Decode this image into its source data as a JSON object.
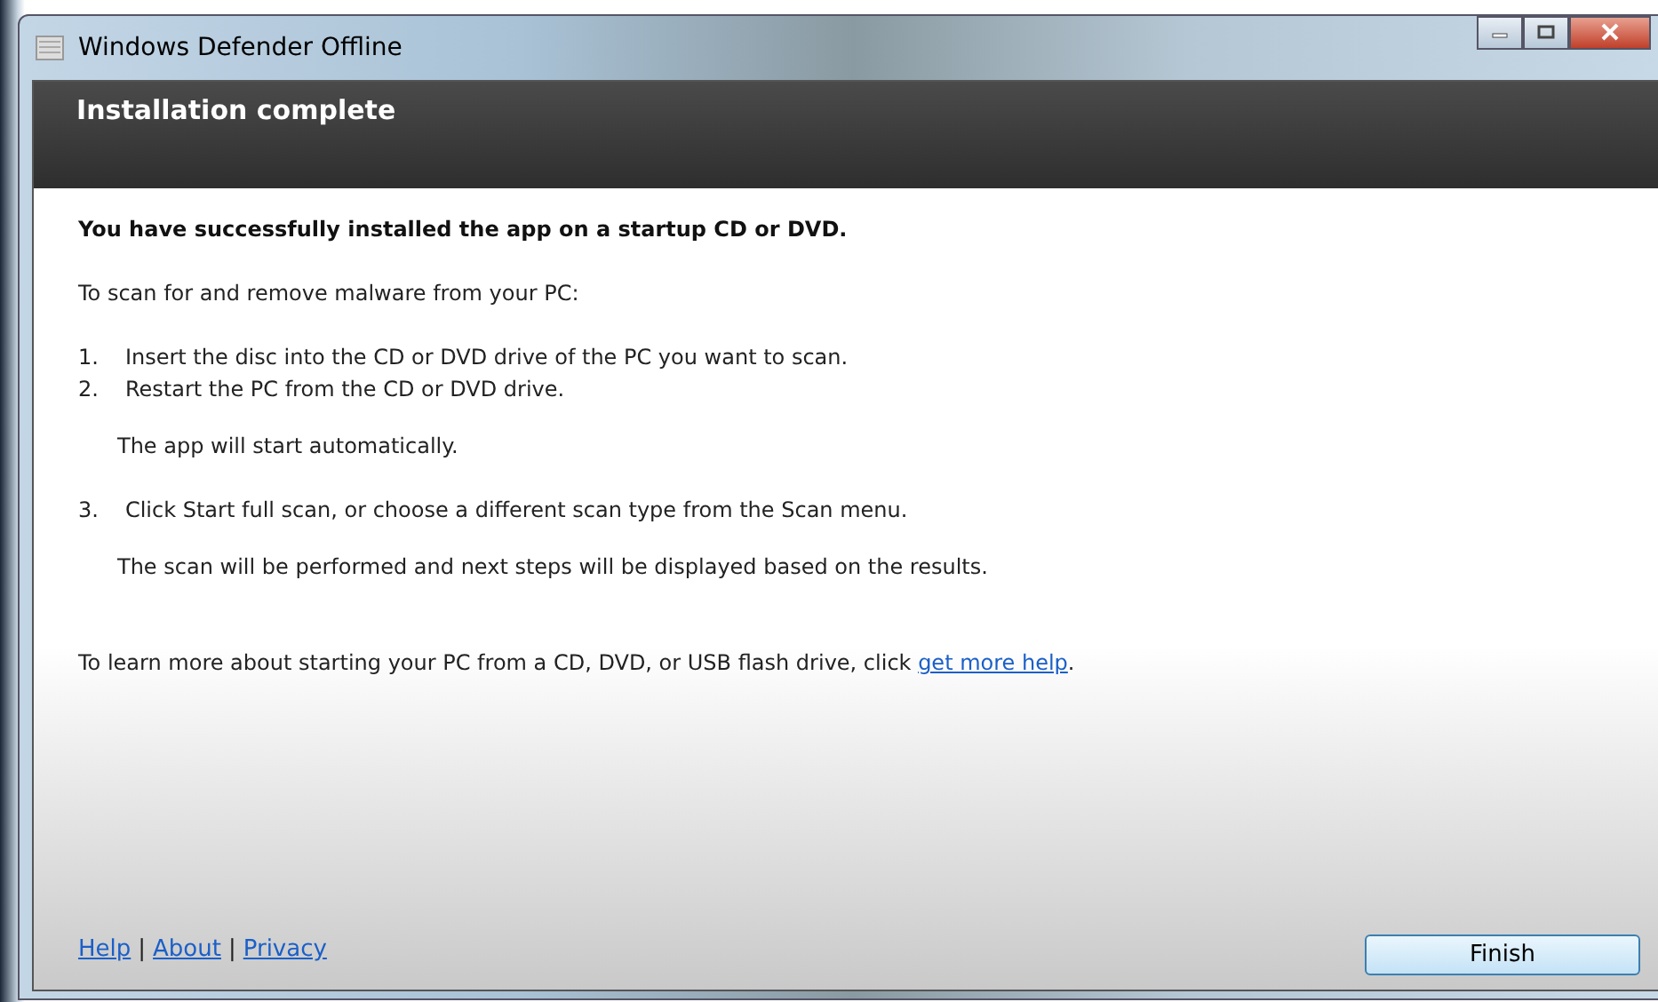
{
  "window": {
    "title": "Windows Defender Offline"
  },
  "header": {
    "title": "Installation complete"
  },
  "content": {
    "heading": "You have successfully installed the app on a startup CD or DVD.",
    "intro": "To scan for and remove malware from your PC:",
    "steps": [
      {
        "number": "1.",
        "text": "Insert the disc into the CD or DVD drive of the PC you want to scan."
      },
      {
        "number": "2.",
        "text": "Restart the PC from the CD or DVD drive.",
        "note": "The app will start automatically."
      },
      {
        "number": "3.",
        "text": "Click Start full scan, or choose a different scan type from the Scan menu.",
        "note": "The scan will be performed and next steps will be displayed based on the results."
      }
    ],
    "help_text": "To learn more about starting your PC from a CD, DVD, or USB flash drive, click ",
    "help_link": "get more help",
    "help_end": "."
  },
  "footer": {
    "links": [
      "Help",
      "About",
      "Privacy"
    ],
    "separator": "|",
    "button": "Finish"
  }
}
